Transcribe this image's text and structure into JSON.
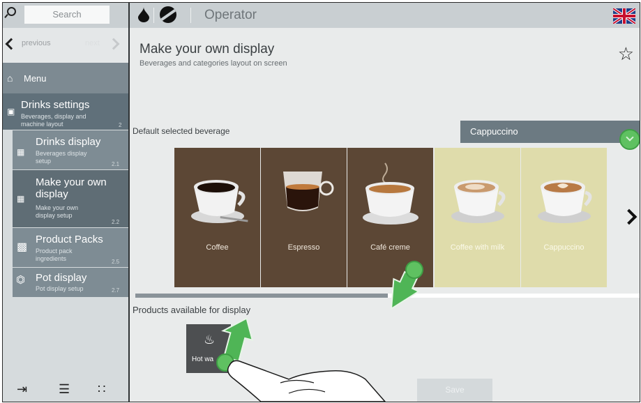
{
  "sidebar": {
    "search_placeholder": "Search",
    "nav": {
      "previous": "previous",
      "next": "next"
    },
    "menu_label": "Menu",
    "items": [
      {
        "title": "Drinks settings",
        "subtitle": "Beverages, display and machine layout",
        "number": "2"
      },
      {
        "title": "Drinks display",
        "subtitle": "Beverages display setup",
        "number": "2.1"
      },
      {
        "title": "Make your own display",
        "subtitle": "Make your own display setup",
        "number": "2.2"
      },
      {
        "title": "Product Packs",
        "subtitle": "Product pack ingredients",
        "number": "2.5"
      },
      {
        "title": "Pot display",
        "subtitle": "Pot display setup",
        "number": "2.7"
      }
    ]
  },
  "topbar": {
    "title": "Operator"
  },
  "main": {
    "title": "Make your own display",
    "subtitle": "Beverages and categories layout on screen",
    "default_label": "Default selected beverage",
    "selected_beverage": "Cappuccino",
    "beverages": [
      {
        "label": "Coffee",
        "style": "dark"
      },
      {
        "label": "Espresso",
        "style": "dark"
      },
      {
        "label": "Café creme",
        "style": "dark"
      },
      {
        "label": "Coffee with milk",
        "style": "light"
      },
      {
        "label": "Cappuccino",
        "style": "light"
      }
    ],
    "scroll_progress": 0.5,
    "products_label": "Products available for display",
    "available_products": [
      {
        "label": "Hot wa"
      }
    ],
    "save_label": "Save"
  },
  "icons": [
    "search-icon",
    "chevron-left-icon",
    "chevron-right-icon",
    "home-icon",
    "drinks-settings-icon",
    "drinks-display-icon",
    "make-display-icon",
    "product-packs-icon",
    "pot-icon",
    "logout-icon",
    "list-star-icon",
    "grid-icon",
    "drop-icon",
    "bean-icon",
    "uk-flag-icon",
    "star-icon",
    "hot-water-icon"
  ],
  "colors": {
    "dark_tile": "#5c4735",
    "light_tile": "#dfdcab",
    "accent_green": "#5fc161"
  }
}
